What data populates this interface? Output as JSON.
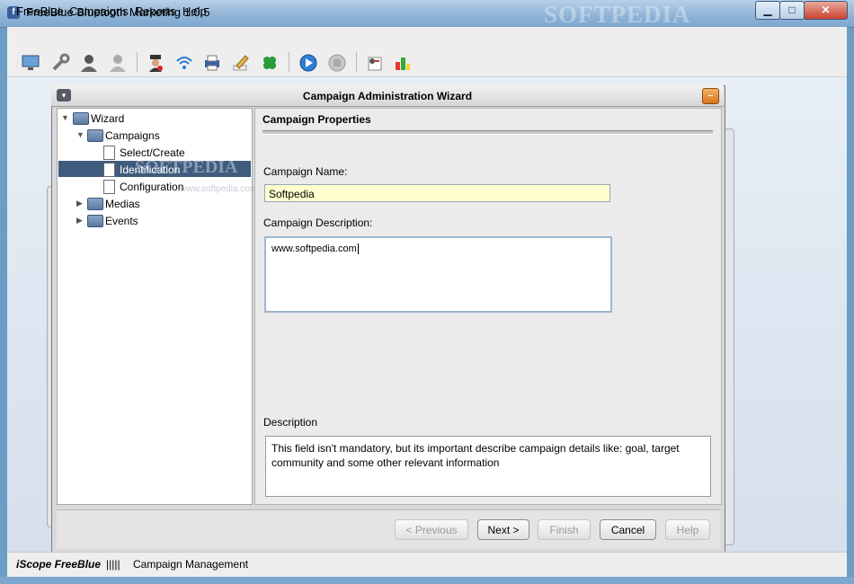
{
  "window": {
    "title": "FreeBlue Bluetooth Marketing 1.0.5",
    "watermark": "SOFTPEDIA",
    "controls": {
      "minimize": "▁",
      "maximize": "□",
      "close": "✕"
    }
  },
  "menu": [
    "FreeBlue",
    "Campaigns",
    "Reports",
    "Help"
  ],
  "toolbar": {
    "icons": [
      "monitor-icon",
      "wrench-icon",
      "user-icon",
      "user-gray-icon",
      "spy-icon",
      "wifi-icon",
      "printer-icon",
      "pencil-icon",
      "clover-icon",
      "play-icon",
      "stop-icon",
      "contact-card-icon",
      "chart-icon"
    ]
  },
  "wizard": {
    "title": "Campaign Administration Wizard",
    "tree": {
      "root": "Wizard",
      "campaigns": "Campaigns",
      "select_create": "Select/Create",
      "identification": "Identification",
      "configuration": "Configuration",
      "medias": "Medias",
      "events": "Events",
      "watermark": "SOFTPEDIA",
      "watermark_small": "www.softpedia.com"
    },
    "section_title": "Campaign Properties",
    "name_label": "Campaign Name:",
    "name_value": "Softpedia",
    "desc_label": "Campaign Description:",
    "desc_value": "www.softpedia.com",
    "help_label": "Description",
    "help_text": "This field isn't mandatory, but its important describe campaign details like: goal, target community and some other relevant information",
    "buttons": {
      "previous": "< Previous",
      "next": "Next >",
      "finish": "Finish",
      "cancel": "Cancel",
      "help": "Help"
    }
  },
  "status": {
    "brand": "iScope FreeBlue",
    "separator": "|||||",
    "text": "Campaign Management"
  }
}
